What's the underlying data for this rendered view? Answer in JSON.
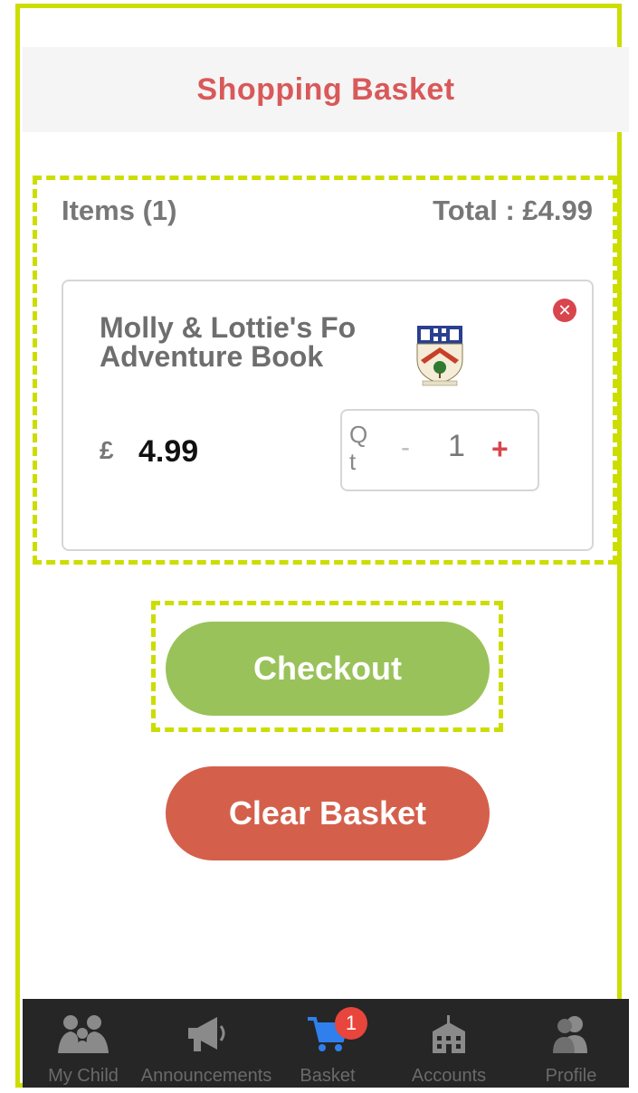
{
  "header": {
    "title": "Shopping Basket"
  },
  "summary": {
    "items_label": "Items (1)",
    "total_label": "Total :  £4.99"
  },
  "item": {
    "name": "Molly & Lottie's Fo\nAdventure Book",
    "currency": "£",
    "price": "4.99",
    "qty_label": "Qt",
    "qty_minus": "-",
    "qty_value": "1",
    "qty_plus": "+",
    "remove_icon": "close-icon"
  },
  "actions": {
    "checkout": "Checkout",
    "clear": "Clear Basket"
  },
  "tabbar": {
    "tabs": [
      {
        "label": "My Child",
        "icon": "family-icon"
      },
      {
        "label": "Announcements",
        "icon": "megaphone-icon"
      },
      {
        "label": "Basket",
        "icon": "cart-icon",
        "badge": "1"
      },
      {
        "label": "Accounts",
        "icon": "school-building-icon"
      },
      {
        "label": "Profile",
        "icon": "people-icon"
      }
    ]
  },
  "colors": {
    "accent_title": "#d9595a",
    "checkout": "#99c25a",
    "clear": "#d4604c",
    "highlight_border": "#ccdd00",
    "active_tab": "#2f80ed",
    "badge": "#e8453c"
  }
}
